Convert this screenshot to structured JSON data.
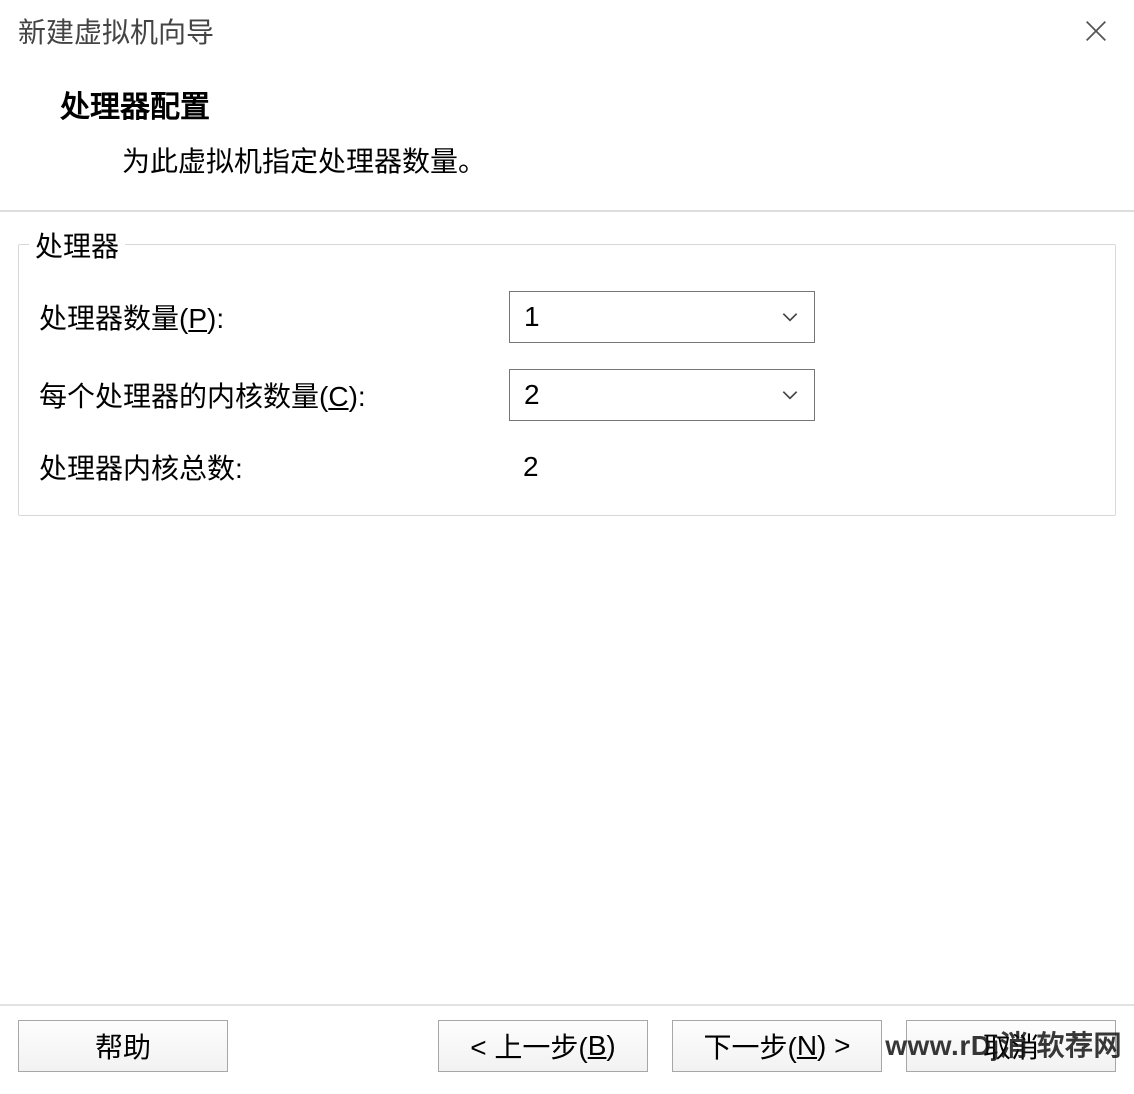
{
  "window": {
    "title": "新建虚拟机向导"
  },
  "header": {
    "title": "处理器配置",
    "subtitle": "为此虚拟机指定处理器数量。"
  },
  "group": {
    "legend": "处理器",
    "rows": {
      "processor_count": {
        "label_pre": "处理器数量(",
        "label_key": "P",
        "label_post": "):",
        "value": "1"
      },
      "cores_per_processor": {
        "label_pre": "每个处理器的内核数量(",
        "label_key": "C",
        "label_post": "):",
        "value": "2"
      },
      "total_cores": {
        "label": "处理器内核总数:",
        "value": "2"
      }
    }
  },
  "buttons": {
    "help": "帮助",
    "back_pre": "< 上一步(",
    "back_key": "B",
    "back_post": ")",
    "next_pre": "下一步(",
    "next_key": "N",
    "next_post": ") >",
    "cancel": "取消"
  },
  "watermark": "www.rDj消 软荐网"
}
